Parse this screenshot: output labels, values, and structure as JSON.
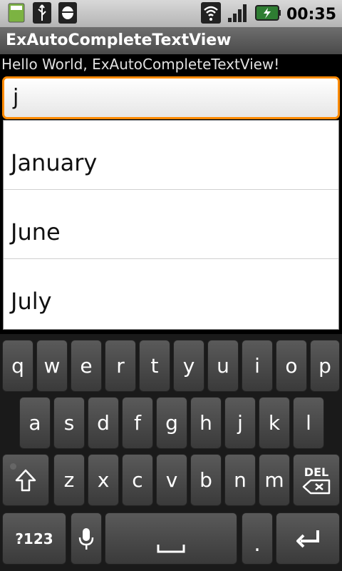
{
  "statusbar": {
    "time": "00:35",
    "icons_left": [
      "sd-card-icon",
      "usb-icon",
      "android-debug-icon"
    ],
    "icons_right": [
      "wifi-icon",
      "signal-icon",
      "battery-charging-icon"
    ]
  },
  "app": {
    "title": "ExAutoCompleteTextView",
    "hello": "Hello World, ExAutoCompleteTextView!"
  },
  "autocomplete": {
    "value": "j",
    "suggestions": [
      "January",
      "June",
      "July"
    ]
  },
  "keyboard": {
    "row1": [
      "q",
      "w",
      "e",
      "r",
      "t",
      "y",
      "u",
      "i",
      "o",
      "p"
    ],
    "row2": [
      "a",
      "s",
      "d",
      "f",
      "g",
      "h",
      "j",
      "k",
      "l"
    ],
    "row3": [
      "z",
      "x",
      "c",
      "v",
      "b",
      "n",
      "m"
    ],
    "del_label": "DEL",
    "symbols_label": "?123",
    "period_label": "."
  },
  "colors": {
    "accent": "#ff8a00",
    "key": "#4a4a4a"
  }
}
